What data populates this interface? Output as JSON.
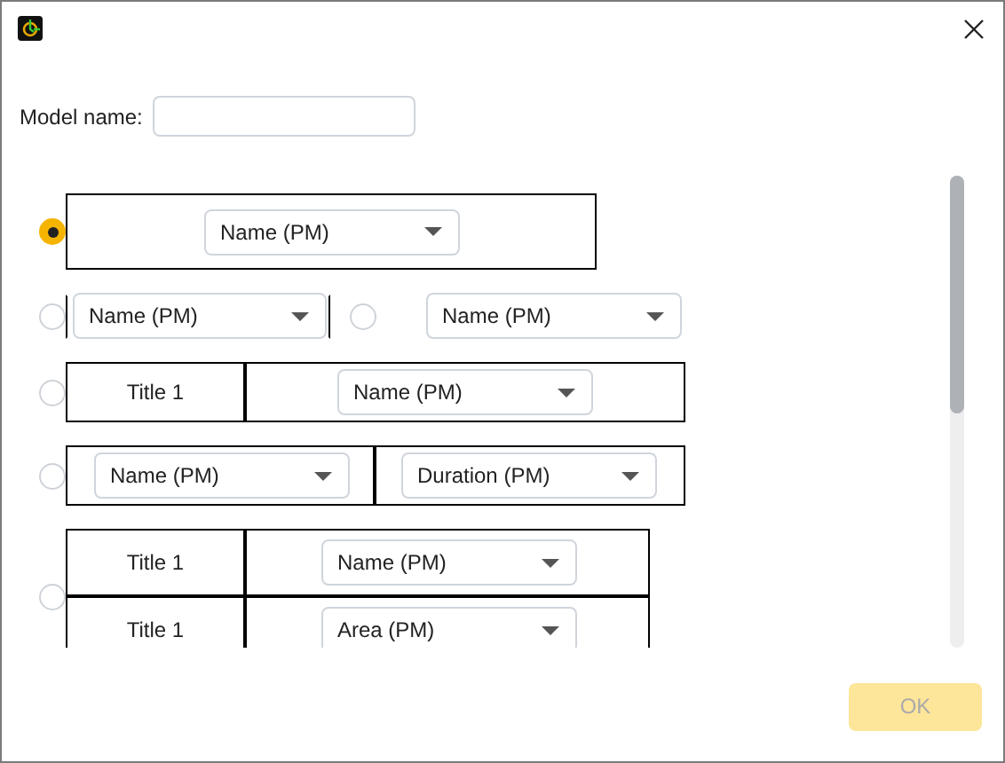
{
  "model_name": {
    "label": "Model name:"
  },
  "options": [
    {
      "kind": "single",
      "selected": true,
      "dropdown": "Name (PM)"
    },
    {
      "kind": "pair",
      "selected": false,
      "dropdown": "Name (PM)",
      "second": {
        "selected": false,
        "dropdown": "Name (PM)"
      }
    },
    {
      "kind": "titled",
      "selected": false,
      "title": "Title 1",
      "dropdown": "Name (PM)"
    },
    {
      "kind": "split",
      "selected": false,
      "dropdowns": [
        "Name (PM)",
        "Duration (PM)"
      ]
    },
    {
      "kind": "table",
      "selected": false,
      "rows": [
        {
          "title": "Title 1",
          "dropdown": "Name (PM)"
        },
        {
          "title": "Title 1",
          "dropdown": "Area (PM)"
        }
      ]
    }
  ],
  "ok_button": {
    "label": "OK",
    "disabled": true
  }
}
